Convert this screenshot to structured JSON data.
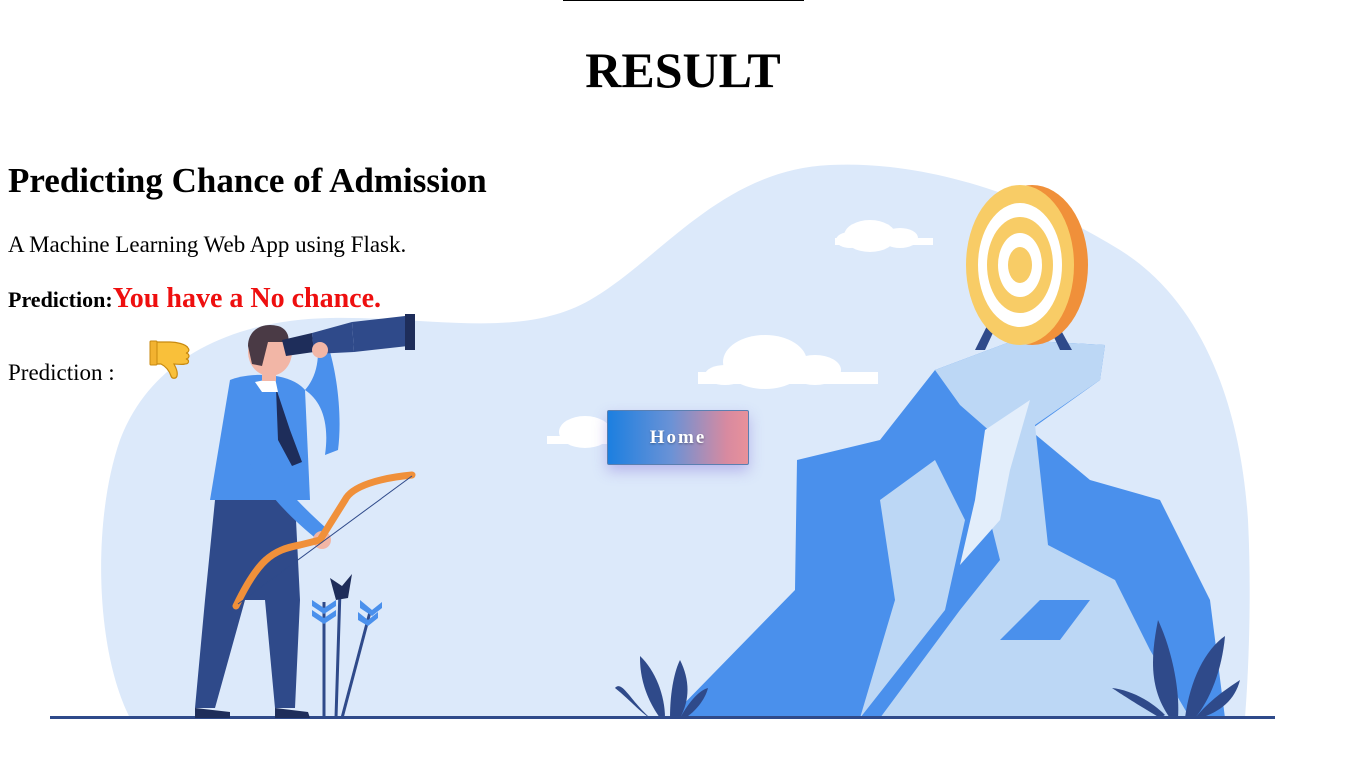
{
  "page": {
    "heading": "RESULT",
    "app_title": "Predicting Chance of Admission",
    "subtitle": "A Machine Learning Web App using Flask."
  },
  "prediction": {
    "label": "Prediction:",
    "value": "You have a No chance.",
    "value_color": "#ee0f0f",
    "second_label": "Prediction :",
    "icon": "thumbs-down-icon"
  },
  "home_button": {
    "label": "Home"
  },
  "colors": {
    "background_blob": "#dce9fa",
    "accent_blue": "#4a90ec",
    "dark_blue": "#2f4a8a",
    "target_yellow": "#f8cc66",
    "bow_orange": "#f0903a"
  }
}
